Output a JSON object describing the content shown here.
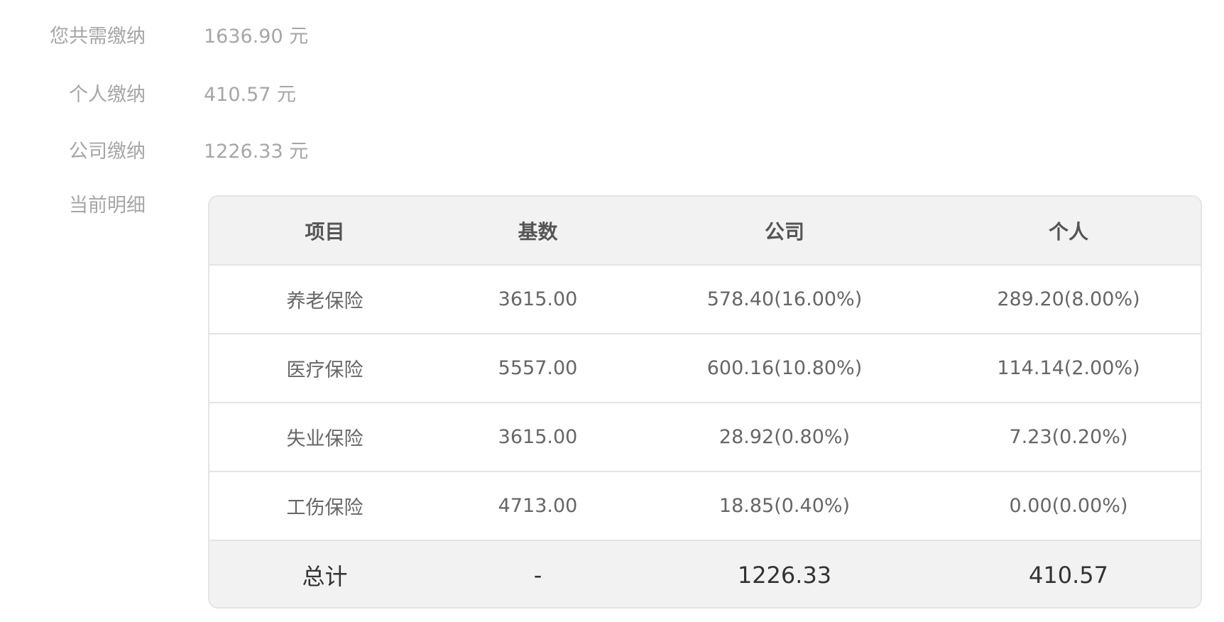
{
  "summary": {
    "total": {
      "label": "您共需缴纳",
      "value": "1636.90 元"
    },
    "personal": {
      "label": "个人缴纳",
      "value": "410.57 元"
    },
    "company": {
      "label": "公司缴纳",
      "value": "1226.33 元"
    }
  },
  "detail": {
    "label": "当前明细",
    "headers": [
      "项目",
      "基数",
      "公司",
      "个人"
    ],
    "rows": [
      [
        "养老保险",
        "3615.00",
        "578.40(16.00%)",
        "289.20(8.00%)"
      ],
      [
        "医疗保险",
        "5557.00",
        "600.16(10.80%)",
        "114.14(2.00%)"
      ],
      [
        "失业保险",
        "3615.00",
        "28.92(0.80%)",
        "7.23(0.20%)"
      ],
      [
        "工伤保险",
        "4713.00",
        "18.85(0.40%)",
        "0.00(0.00%)"
      ]
    ],
    "footer": [
      "总计",
      "-",
      "1226.33",
      "410.57"
    ]
  }
}
